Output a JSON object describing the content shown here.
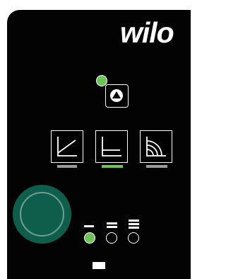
{
  "brand": {
    "logo_text": "wilo"
  },
  "colors": {
    "panel": "#030303",
    "led_on": "#6ec15b",
    "led_off": "#ffffff",
    "bar_active": "#6ec15b",
    "bar_inactive": "#9a9a9a",
    "knob": "#0e5e4b"
  },
  "icons": {
    "mode_button": "pump-triangle-icon",
    "control_modes": [
      "variable-pressure-curve-icon",
      "constant-pressure-curve-icon",
      "fixed-speed-curves-icon"
    ]
  },
  "status": {
    "mode_led": "on",
    "control_mode_selected": 2,
    "speed_stage_selected": 1
  }
}
